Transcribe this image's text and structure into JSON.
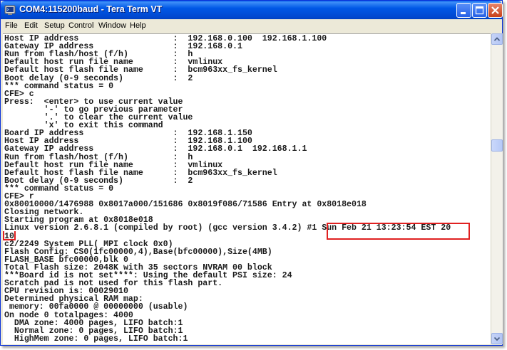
{
  "window": {
    "title": "COM4:115200baud - Tera Term VT"
  },
  "menu": [
    "File",
    "Edit",
    "Setup",
    "Control",
    "Window",
    "Help"
  ],
  "terminal": {
    "lines": [
      "Host IP address                   :  192.168.0.100  192.168.1.100",
      "Gateway IP address                :  192.168.0.1",
      "Run from flash/host (f/h)         :  h",
      "Default host run file name        :  vmlinux",
      "Default host flash file name      :  bcm963xx_fs_kernel",
      "Boot delay (0-9 seconds)          :  2",
      "*** command status = 0",
      "CFE> c",
      "Press:  <enter> to use current value",
      "        '-' to go previous parameter",
      "        '.' to clear the current value",
      "        'x' to exit this command",
      "Board IP address                  :  192.168.1.150",
      "Host IP address                   :  192.168.1.100",
      "Gateway IP address                :  192.168.0.1  192.168.1.1",
      "Run from flash/host (f/h)         :  h",
      "Default host run file name        :  vmlinux",
      "Default host flash file name      :  bcm963xx_fs_kernel",
      "Boot delay (0-9 seconds)          :  2",
      "*** command status = 0",
      "CFE> r",
      "0x80010000/1476988 0x8017a000/151686 0x8019f086/71586 Entry at 0x8018e018",
      "Closing network.",
      "Starting program at 0x8018e018",
      "Linux version 2.6.8.1 (compiled by root) (gcc version 3.4.2) #1 Sun Feb 21 13:23:54 EST 20",
      "10",
      "c2/2249 System PLL( MPI clock 0x0)",
      "Flash Config: CS0(1fc00000,4),Base(bfc00000),Size(4MB)",
      "FLASH_BASE bfc00000,blk 0",
      "Total Flash size: 2048K with 35 sectors NVRAM 00 block",
      "***Board id is not set****: Using the default PSI size: 24",
      "Scratch pad is not used for this flash part.",
      "CPU revision is: 00029010",
      "Determined physical RAM map:",
      " memory: 00fa0000 @ 00000000 (usable)",
      "On node 0 totalpages: 4000",
      "  DMA zone: 4000 pages, LIFO batch:1",
      "  Normal zone: 0 pages, LIFO batch:1",
      "  HighMem zone: 0 pages, LIFO batch:1"
    ]
  },
  "colors": {
    "titlebar": "#0058e6",
    "highlight": "#e02020",
    "terminal_bg": "#ffffff",
    "terminal_fg": "#1a1a1a"
  },
  "icons": [
    "terminal-app-icon",
    "minimize-icon",
    "maximize-icon",
    "close-icon",
    "scroll-up-icon",
    "scroll-down-icon"
  ]
}
